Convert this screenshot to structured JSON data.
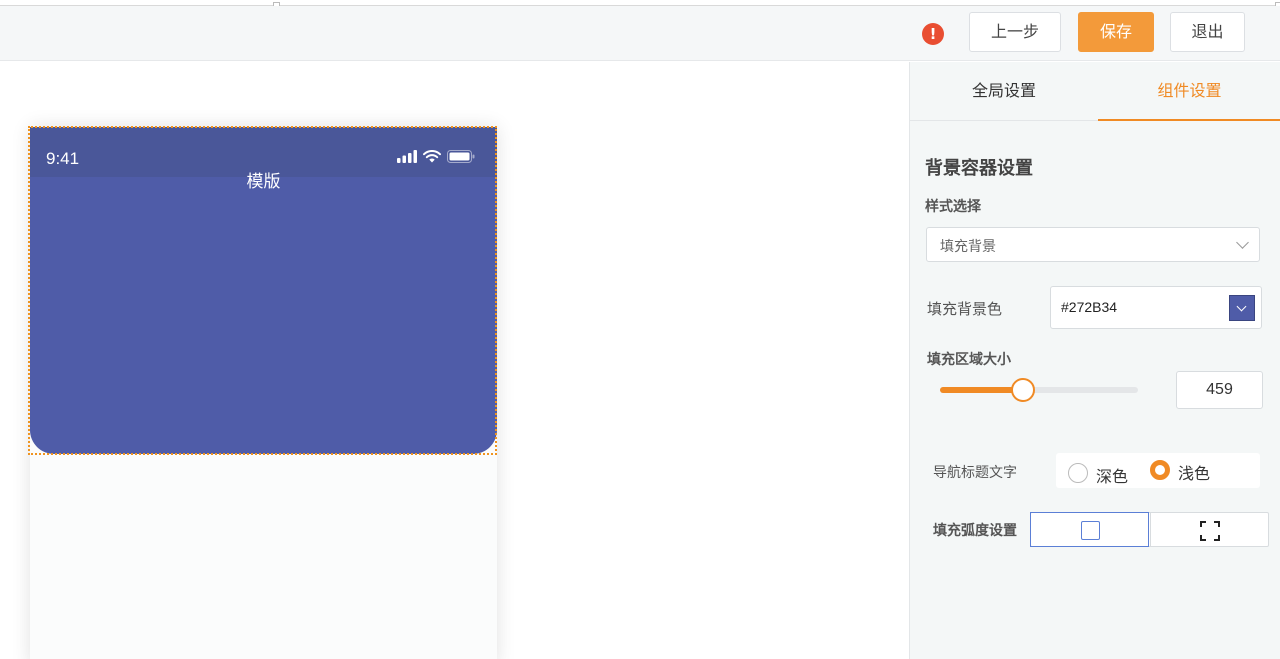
{
  "header": {
    "warning_icon": "exclamation-circle-icon",
    "prev_label": "上一步",
    "save_label": "保存",
    "exit_label": "退出",
    "accent_color": "#f39a3a"
  },
  "preview": {
    "status_time": "9:41",
    "nav_title": "模版",
    "status_icons": [
      "signal-icon",
      "wifi-icon",
      "battery-icon"
    ],
    "background_color": "#4f5ca8"
  },
  "panel": {
    "tabs": [
      {
        "label": "全局设置",
        "active": false
      },
      {
        "label": "组件设置",
        "active": true
      }
    ],
    "section_title": "背景容器设置",
    "style_select": {
      "label": "样式选择",
      "value": "填充背景"
    },
    "fill_color": {
      "label": "填充背景色",
      "value": "#272B34"
    },
    "fill_size": {
      "label": "填充区域大小",
      "value": "459",
      "slider_fraction": 0.42
    },
    "nav_text": {
      "label": "导航标题文字",
      "options": [
        {
          "label": "深色",
          "checked": false
        },
        {
          "label": "浅色",
          "checked": true
        }
      ]
    },
    "fill_radius": {
      "label": "填充弧度设置",
      "options": [
        {
          "icon": "square-rounded-icon",
          "selected": true
        },
        {
          "icon": "fullscreen-corners-icon",
          "selected": false
        }
      ]
    }
  }
}
